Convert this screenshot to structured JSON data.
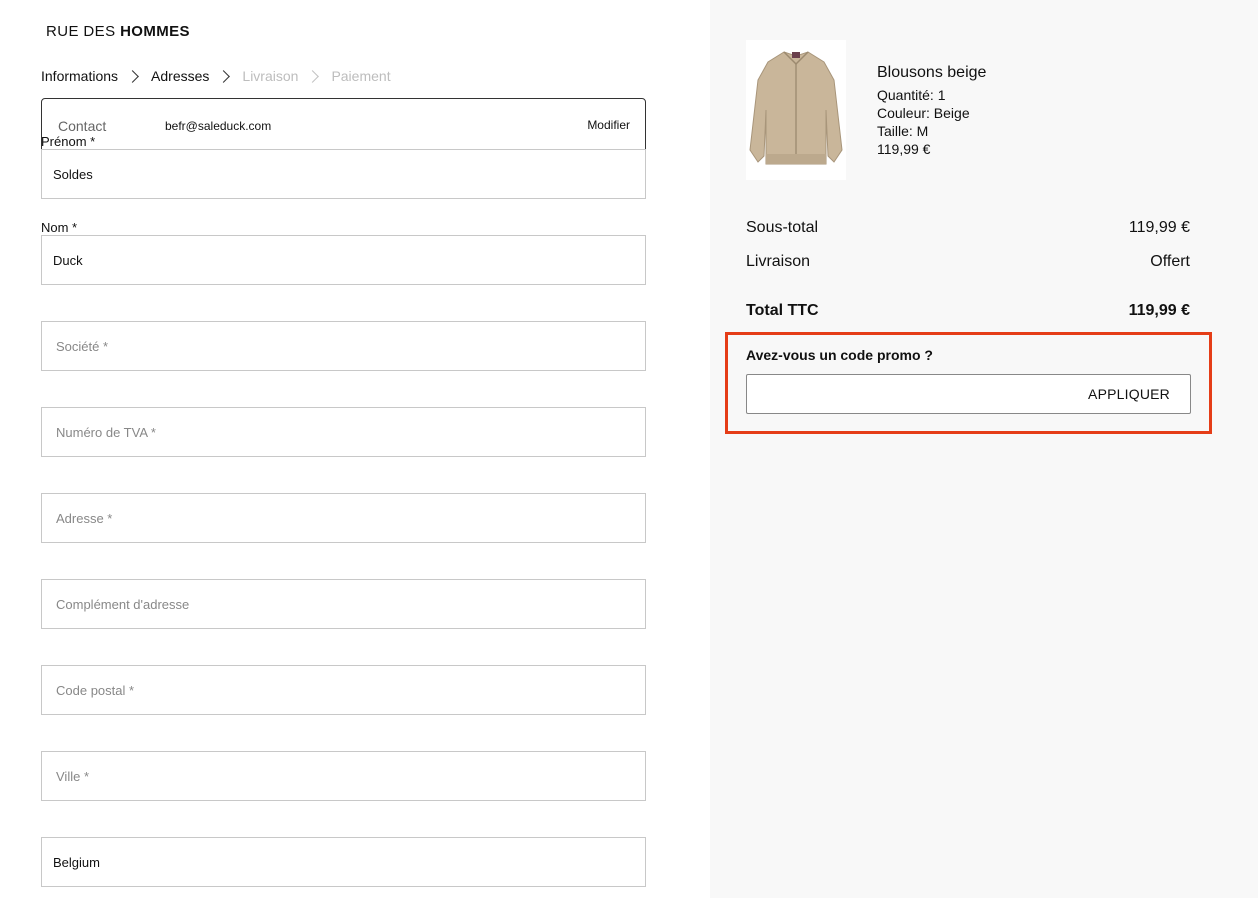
{
  "brand": {
    "logo_part1": "RUE DES ",
    "logo_part2": "HOMMES"
  },
  "breadcrumb": [
    {
      "label": "Informations",
      "state": "done"
    },
    {
      "label": "Adresses",
      "state": "current"
    },
    {
      "label": "Livraison",
      "state": "disabled"
    },
    {
      "label": "Paiement",
      "state": "disabled"
    }
  ],
  "contact": {
    "label": "Contact",
    "email": "befr@saleduck.com",
    "modify_label": "Modifier"
  },
  "form": {
    "prenom": {
      "label": "Prénom *",
      "value": "Soldes"
    },
    "nom": {
      "label": "Nom *",
      "value": "Duck"
    },
    "societe": {
      "placeholder": "Société *"
    },
    "tva": {
      "placeholder": "Numéro de TVA *"
    },
    "adresse": {
      "placeholder": "Adresse *"
    },
    "complement": {
      "placeholder": "Complément d'adresse"
    },
    "code_postal": {
      "placeholder": "Code postal *"
    },
    "ville": {
      "placeholder": "Ville *"
    },
    "pays": {
      "value": "Belgium"
    }
  },
  "product": {
    "name": "Blousons beige",
    "quantity": "Quantité: 1",
    "color": "Couleur: Beige",
    "size": "Taille: M",
    "price": "119,99 €",
    "image_color": "#c9b69a"
  },
  "summary": {
    "subtotal_label": "Sous-total",
    "subtotal_value": "119,99 €",
    "shipping_label": "Livraison",
    "shipping_value": "Offert",
    "total_label": "Total TTC",
    "total_value": "119,99 €"
  },
  "promo": {
    "title": "Avez-vous un code promo ?",
    "apply_label": "APPLIQUER",
    "highlight_color": "#e53d17"
  }
}
